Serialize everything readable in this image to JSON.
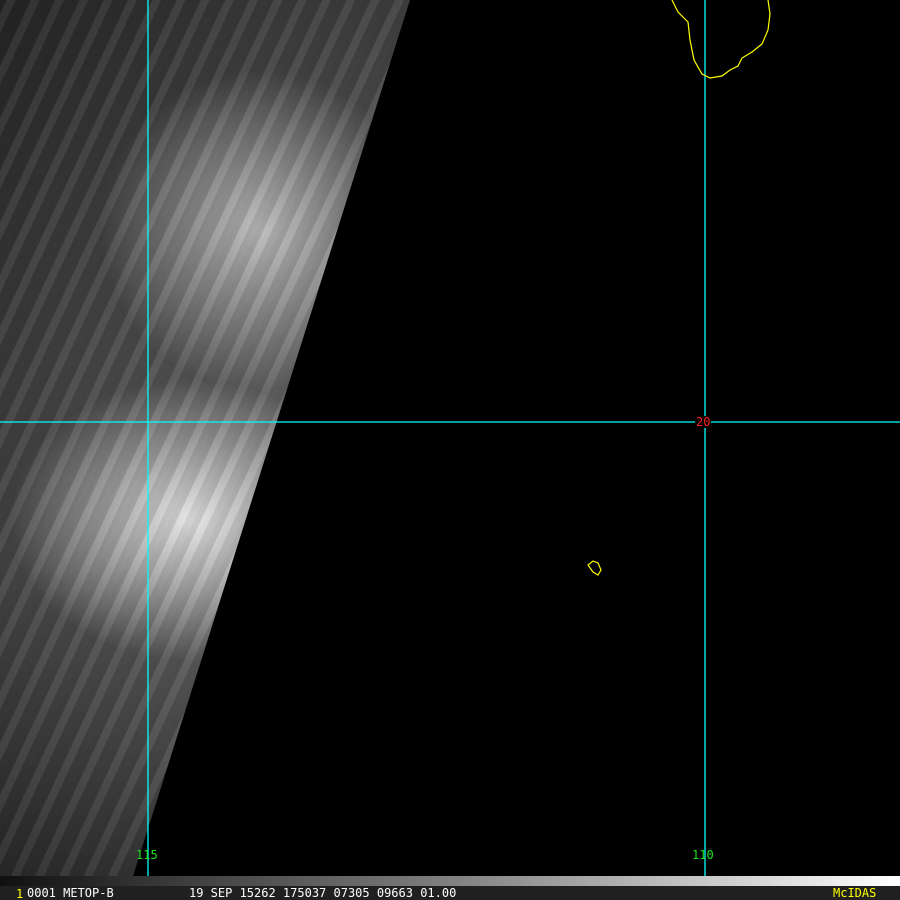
{
  "map": {
    "grid_color": "#00ffff",
    "coast_color": "#ffff00",
    "lat_labels": [
      {
        "text": "20",
        "color": "#ff2020"
      }
    ],
    "lon_labels": [
      {
        "text": "115",
        "color": "#20e020"
      },
      {
        "text": "110",
        "color": "#20e020"
      }
    ]
  },
  "infobar": {
    "frame": "1",
    "satellite": "0001 METOP-B",
    "datetime": "19 SEP 15262 175037 07305 09663 01.00",
    "brand": "McIDAS"
  }
}
